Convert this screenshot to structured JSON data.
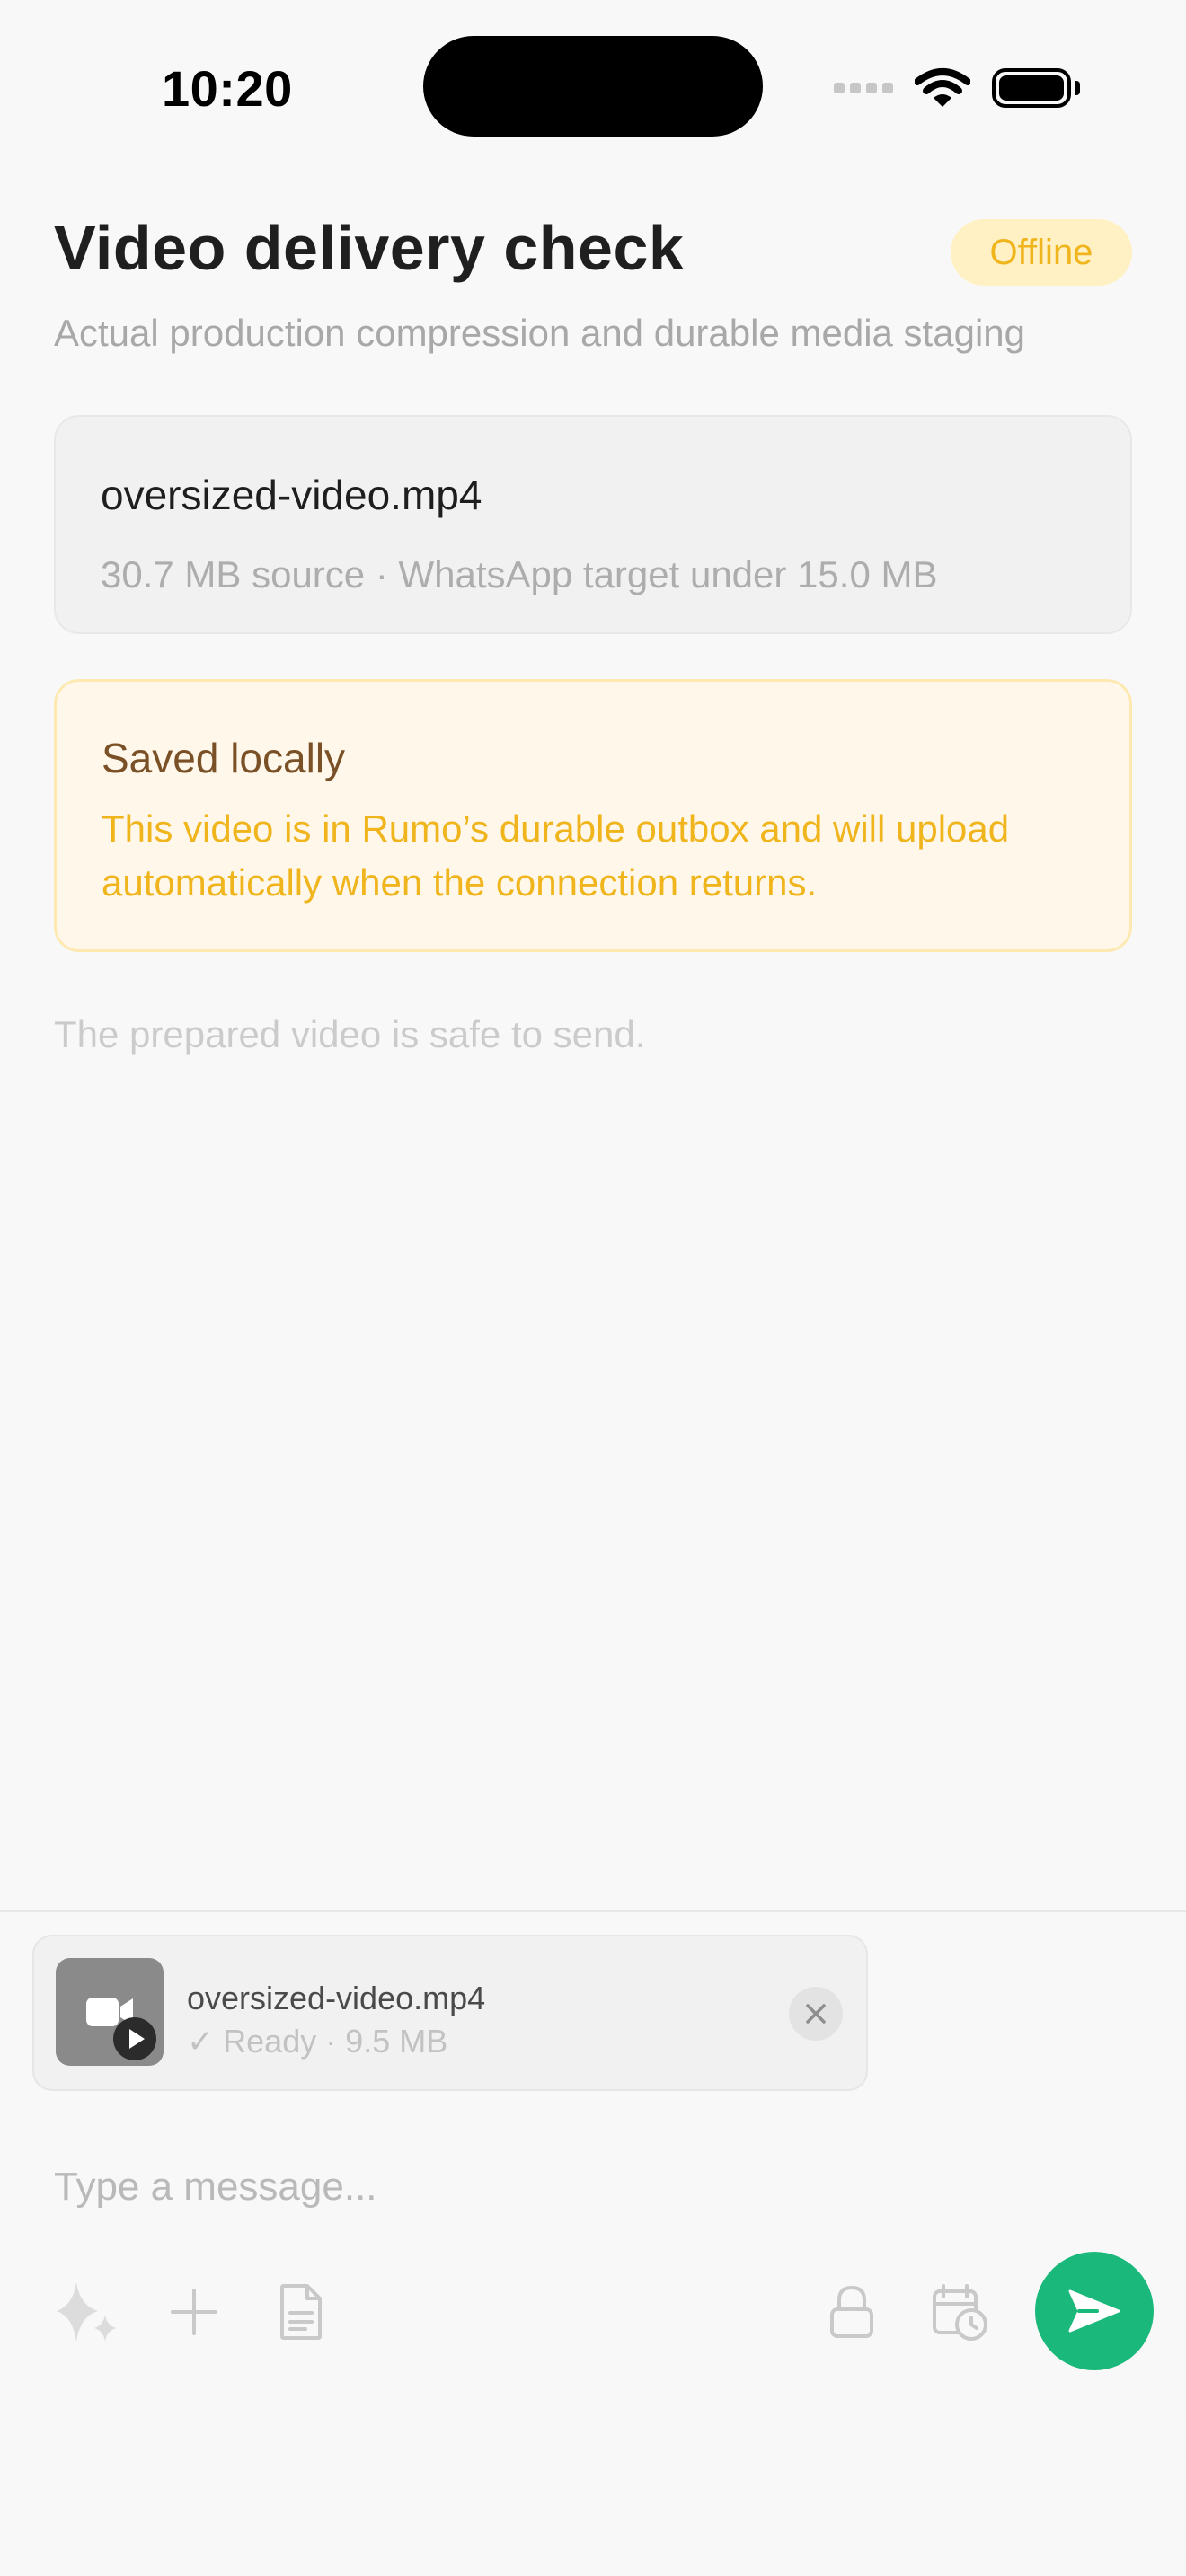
{
  "status_bar": {
    "time": "10:20"
  },
  "header": {
    "title": "Video delivery check",
    "status_badge": "Offline",
    "subtitle": "Actual production compression and durable media staging"
  },
  "file_card": {
    "name": "oversized-video.mp4",
    "meta": "30.7 MB source · WhatsApp target under 15.0 MB"
  },
  "saved_card": {
    "heading": "Saved locally",
    "body_line1": "This video is in Rumo’s durable outbox and will upload",
    "body_line2": "automatically when the connection returns."
  },
  "safe_note": "The prepared video is safe to send.",
  "composer": {
    "attachment": {
      "name": "oversized-video.mp4",
      "status": "✓ Ready · 9.5 MB",
      "icon": "video-camera-icon"
    },
    "input_placeholder": "Type a message...",
    "input_value": "",
    "tools_left": [
      "sparkles-icon",
      "plus-icon",
      "document-icon"
    ],
    "tools_right": [
      "lock-icon",
      "calendar-clock-icon"
    ],
    "send_icon": "send-icon"
  },
  "colors": {
    "accent_green": "#1ab87a",
    "offline_badge_bg": "#fff1c4",
    "offline_badge_text": "#f0b51d",
    "warning_heading": "#7a5027",
    "warning_text": "#f0b51d"
  }
}
